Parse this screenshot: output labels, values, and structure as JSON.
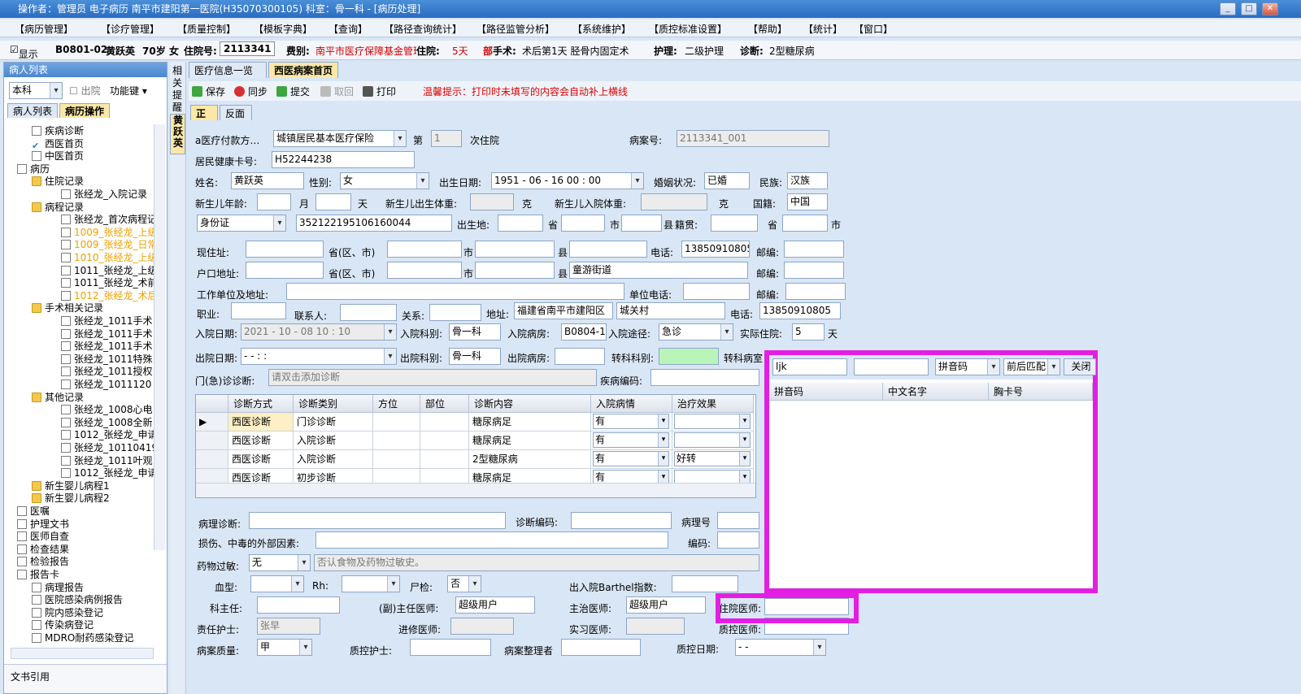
{
  "window": {
    "title": "操作者：管理员 电子病历  南平市建阳第一医院(H35070300105)  科室：骨一科 - [病历处理]"
  },
  "menu": [
    "【病历管理】",
    "【诊疗管理】",
    "【质量控制】",
    "【模板字典】",
    "【查询】",
    "【路径查询统计】",
    "【路径监管分析】",
    "【系统维护】",
    "【质控标准设置】",
    "【帮助】",
    "【统计】",
    "【窗口】"
  ],
  "infobar": {
    "show": "显示",
    "bed": "B0801-02",
    "name": "黄跃英",
    "age": "70岁",
    "sex": "女",
    "inpatient_no_label": "住院号:",
    "inpatient_no": "2113341",
    "fee_label": "费别:",
    "fee": "南平市医疗保障基金管理中",
    "stay_label": "住院:",
    "stay": "5天",
    "dept_label": "部",
    "surgery_label": "手术:",
    "surgery": "术后第1天 胫骨内固定术",
    "nursing_label": "护理:",
    "nursing": "二级护理",
    "diag_label": "诊断:",
    "diag": "2型糖尿病"
  },
  "left": {
    "header": "病人列表",
    "dept": "本科",
    "discharged": "出院",
    "func": "功能键",
    "tab1": "病人列表",
    "tab2": "病历操作",
    "footer": "文书引用",
    "tree": [
      {
        "t": "疾病诊断",
        "l": 1,
        "i": "doc"
      },
      {
        "t": "西医首页",
        "l": 1,
        "i": "check"
      },
      {
        "t": "中医首页",
        "l": 1,
        "i": "doc"
      },
      {
        "t": "病历",
        "l": 0,
        "i": "doc"
      },
      {
        "t": "住院记录",
        "l": 1,
        "i": "fold"
      },
      {
        "t": "张经龙_入院记录",
        "l": 3,
        "i": "doc"
      },
      {
        "t": "病程记录",
        "l": 1,
        "i": "fold"
      },
      {
        "t": "张经龙_首次病程记",
        "l": 3,
        "i": "doc"
      },
      {
        "t": "1009_张经龙_上级",
        "l": 3,
        "i": "doc",
        "o": 1
      },
      {
        "t": "1009_张经龙_日常",
        "l": 3,
        "i": "doc",
        "o": 1
      },
      {
        "t": "1010_张经龙_上级",
        "l": 3,
        "i": "doc",
        "o": 1
      },
      {
        "t": "1011_张经龙_上级",
        "l": 3,
        "i": "doc"
      },
      {
        "t": "1011_张经龙_术前",
        "l": 3,
        "i": "doc"
      },
      {
        "t": "1012_张经龙_术后",
        "l": 3,
        "i": "doc",
        "o": 1
      },
      {
        "t": "手术相关记录",
        "l": 1,
        "i": "fold"
      },
      {
        "t": "张经龙_1011手术",
        "l": 3,
        "i": "doc"
      },
      {
        "t": "张经龙_1011手术",
        "l": 3,
        "i": "doc"
      },
      {
        "t": "张经龙_1011手术",
        "l": 3,
        "i": "doc"
      },
      {
        "t": "张经龙_1011特殊",
        "l": 3,
        "i": "doc"
      },
      {
        "t": "张经龙_1011授权",
        "l": 3,
        "i": "doc"
      },
      {
        "t": "张经龙_1011120",
        "l": 3,
        "i": "doc"
      },
      {
        "t": "其他记录",
        "l": 1,
        "i": "fold"
      },
      {
        "t": "张经龙_1008心电",
        "l": 3,
        "i": "doc"
      },
      {
        "t": "张经龙_1008全新",
        "l": 3,
        "i": "doc"
      },
      {
        "t": "1012_张经龙_申请",
        "l": 3,
        "i": "doc"
      },
      {
        "t": "张经龙_10110419",
        "l": 3,
        "i": "doc"
      },
      {
        "t": "张经龙_1011叶观",
        "l": 3,
        "i": "doc"
      },
      {
        "t": "1012_张经龙_申请",
        "l": 3,
        "i": "doc"
      },
      {
        "t": "新生婴儿病程1",
        "l": 1,
        "i": "fold"
      },
      {
        "t": "新生婴儿病程2",
        "l": 1,
        "i": "fold"
      },
      {
        "t": "医嘱",
        "l": 0,
        "i": "doc"
      },
      {
        "t": "护理文书",
        "l": 0,
        "i": "doc"
      },
      {
        "t": "医师自查",
        "l": 0,
        "i": "doc"
      },
      {
        "t": "检查结果",
        "l": 0,
        "i": "doc"
      },
      {
        "t": "检验报告",
        "l": 0,
        "i": "doc"
      },
      {
        "t": "报告卡",
        "l": 0,
        "i": "doc"
      },
      {
        "t": "病理报告",
        "l": 1,
        "i": "doc"
      },
      {
        "t": "医院感染病例报告",
        "l": 1,
        "i": "doc"
      },
      {
        "t": "院内感染登记",
        "l": 1,
        "i": "doc"
      },
      {
        "t": "传染病登记",
        "l": 1,
        "i": "doc"
      },
      {
        "t": "MDRO耐药感染登记",
        "l": 1,
        "i": "doc"
      }
    ]
  },
  "side": {
    "strip1": "相关提醒",
    "strip2": "黄跃英"
  },
  "tabs": [
    "医疗信息一览表",
    "西医病案首页"
  ],
  "subtabs": [
    "正面",
    "反面"
  ],
  "toolbar": {
    "save": "保存",
    "sync": "同步",
    "submit": "提交",
    "retrieve": "取回",
    "print": "打印",
    "hint": "温馨提示：打印时未填写的内容会自动补上横线"
  },
  "form": {
    "pay_label": "a医疗付款方…",
    "pay": "城镇居民基本医疗保险",
    "times_label": "第",
    "times": "1",
    "times_suffix": "次住院",
    "case_no_label": "病案号:",
    "case_no": "2113341_001",
    "health_card_label": "居民健康卡号:",
    "health_card": "H52244238",
    "name_label": "姓名:",
    "name": "黄跃英",
    "sex_label": "性别:",
    "sex": "女",
    "birth_label": "出生日期:",
    "birth": "1951 - 06 - 16   00 : 00",
    "marital_label": "婚姻状况:",
    "marital": "已婚",
    "nation_label": "民族:",
    "nation": "汉族",
    "newborn_age_label": "新生儿年龄:",
    "month": "月",
    "day": "天",
    "newborn_weight_label": "新生儿出生体重:",
    "gram": "克",
    "newborn_admit_weight_label": "新生儿入院体重:",
    "gram2": "克",
    "country_label": "国籍:",
    "country": "中国",
    "id_type": "身份证",
    "id_no": "352122195106160044",
    "birthplace_label": "出生地:",
    "prov": "省",
    "city": "市",
    "county": "县",
    "native_label": "籍贯:",
    "prov2": "省",
    "city2": "市",
    "addr_label": "现住址:",
    "addr_prov": "省(区、市)",
    "addr_city": "市",
    "addr_county": "县",
    "phone_label": "电话:",
    "phone": "13850910805",
    "zip_label": "邮编:",
    "hukou_label": "户口地址:",
    "hukou_prov": "省(区、市)",
    "hukou_city": "市",
    "hukou_county": "县",
    "hukou_street": "童游街道",
    "zip2_label": "邮编:",
    "work_label": "工作单位及地址:",
    "work_phone_label": "单位电话:",
    "zip3_label": "邮编:",
    "job_label": "职业:",
    "contact_label": "联系人:",
    "relation_label": "关系:",
    "caddr_label": "地址:",
    "caddr1": "福建省南平市建阳区",
    "caddr2": "城关村",
    "cphone_label": "电话:",
    "cphone": "13850910805",
    "admit_date_label": "入院日期:",
    "admit_date": "2021 - 10 - 08   10 : 10",
    "admit_dept_label": "入院科别:",
    "admit_dept": "骨一科",
    "admit_ward_label": "入院病房:",
    "admit_ward": "B0804-1",
    "admit_way_label": "入院途径:",
    "admit_way": "急诊",
    "actual_days_label": "实际住院:",
    "actual_days": "5",
    "days_unit": "天",
    "dis_date_label": "出院日期:",
    "dis_date": "-   -        :    :",
    "dis_dept_label": "出院科别:",
    "dis_dept": "骨一科",
    "dis_ward_label": "出院病房:",
    "transfer_label": "转科科别:",
    "transfer_ward_label": "转科病室",
    "er_diag_label": "门(急)诊诊断:",
    "er_diag_ph": "请双击添加诊断",
    "disease_code_label": "疾病编码:",
    "path_diag_label": "病理诊断:",
    "diag_code_label": "诊断编码:",
    "path_no_label": "病理号",
    "injury_label": "损伤、中毒的外部因素:",
    "code_label": "编码:",
    "allergy_label": "药物过敏:",
    "allergy": "无",
    "allergy_note": "否认食物及药物过敏史。",
    "blood_label": "血型:",
    "rh_label": "Rh:",
    "autopsy_label": "尸检:",
    "autopsy": "否",
    "barthel_label": "出入院Barthel指数:",
    "director_label": "科主任:",
    "chief_label": "(副)主任医师:",
    "chief": "超级用户",
    "attending_label": "主治医师:",
    "attending": "超级用户",
    "resident_label": "住院医师:",
    "nurse_label": "责任护士:",
    "nurse": "张早",
    "advanced_label": "进修医师:",
    "intern_label": "实习医师:",
    "qc_doctor_label": "质控医师:",
    "quality_label": "病案质量:",
    "quality": "甲",
    "qc_nurse_label": "质控护士:",
    "organizer_label": "病案整理者",
    "qc_date_label": "质控日期:",
    "qc_date": "-  -"
  },
  "grid": {
    "headers": [
      "诊断方式",
      "诊断类别",
      "方位",
      "部位",
      "诊断内容",
      "入院病情",
      "治疗效果"
    ],
    "rows": [
      [
        "西医诊断",
        "门诊诊断",
        "",
        "",
        "糖尿病足",
        "有",
        ""
      ],
      [
        "西医诊断",
        "入院诊断",
        "",
        "",
        "糖尿病足",
        "有",
        ""
      ],
      [
        "西医诊断",
        "入院诊断",
        "",
        "",
        "2型糖尿病",
        "有",
        "好转"
      ],
      [
        "西医诊断",
        "初步诊断",
        "",
        "",
        "糖尿病足",
        "有",
        ""
      ]
    ]
  },
  "popup": {
    "input": "ljk",
    "mode": "拼音码",
    "match": "前后匹配",
    "close": "关闭",
    "headers": [
      "拼音码",
      "中文名字",
      "胸卡号"
    ]
  }
}
